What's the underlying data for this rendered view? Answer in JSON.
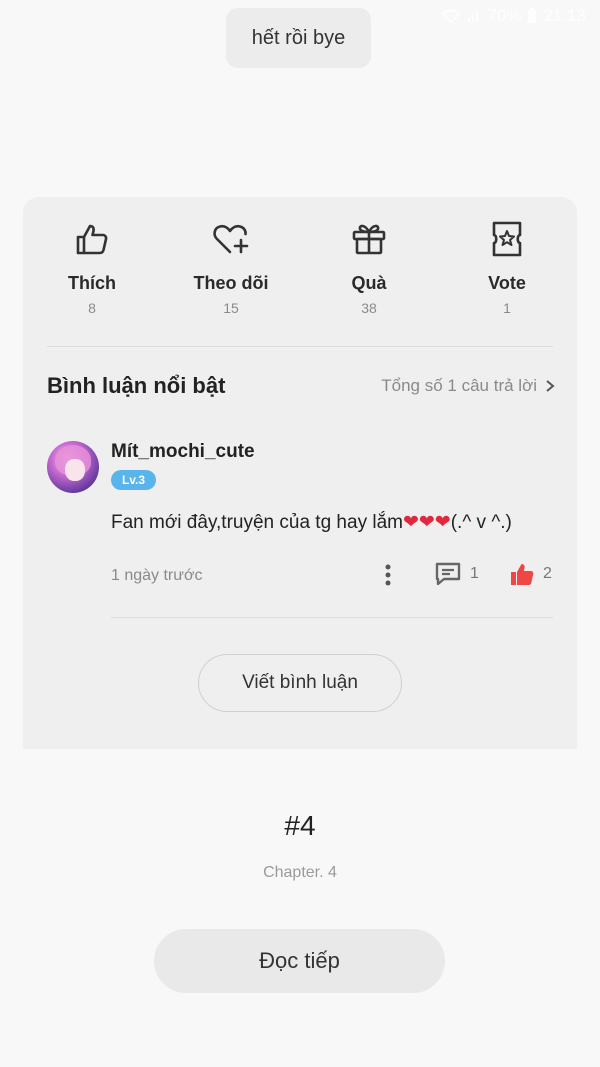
{
  "status_bar": {
    "battery": "70%",
    "time": "21:13"
  },
  "end_message": "hết rồi bye",
  "actions": [
    {
      "label": "Thích",
      "count": "8",
      "icon": "thumbs-up-icon"
    },
    {
      "label": "Theo dõi",
      "count": "15",
      "icon": "heart-plus-icon"
    },
    {
      "label": "Quà",
      "count": "38",
      "icon": "gift-icon"
    },
    {
      "label": "Vote",
      "count": "1",
      "icon": "ticket-star-icon"
    }
  ],
  "comments": {
    "title": "Bình luận nổi bật",
    "total": "Tổng số 1 câu trả lời",
    "items": [
      {
        "username": "Mít_mochi_cute",
        "level": "Lv.3",
        "text_before": "Fan mới đây,truyện của tg hay lắm",
        "hearts": "❤❤❤",
        "text_after": "(.^ v ^.)",
        "time": "1 ngày trước",
        "reply_count": "1",
        "like_count": "2"
      }
    ],
    "write_label": "Viết bình luận"
  },
  "chapter": {
    "number": "#4",
    "name": "Chapter. 4",
    "read_next_label": "Đọc tiếp"
  },
  "colors": {
    "background": "#f8f8f8",
    "panel": "#efefef",
    "level_badge": "#5ab4ec",
    "like_active": "#ef4646",
    "heart": "#e2283e"
  }
}
